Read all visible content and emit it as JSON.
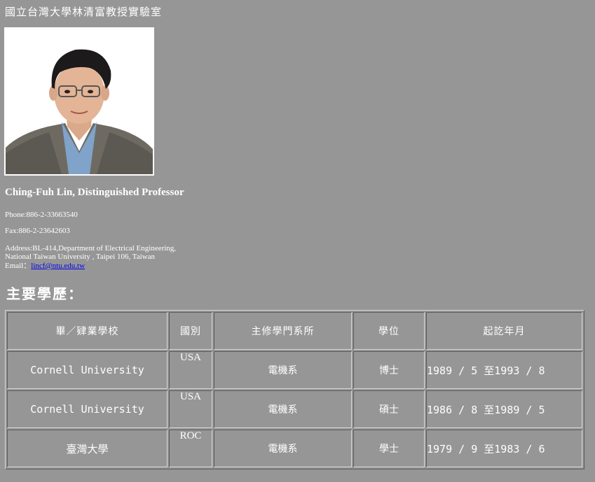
{
  "lab_title": "國立台灣大學林清富教授實驗室",
  "professor": {
    "name": "Ching-Fuh Lin, Distinguished Professor",
    "phone": "Phone:886-2-33663540",
    "fax": "Fax:886-2-23642603",
    "address_line1": "Address:BL-414,Department of Electrical Engineering,",
    "address_line2": "National Taiwan University , Taipei 106, Taiwan",
    "email_label": "Email：",
    "email": "lincf@ntu.edu.tw"
  },
  "education": {
    "section_title": "主要學歷：",
    "headers": [
      "畢／肄業學校",
      "國別",
      "主修學門系所",
      "學位",
      "起訖年月"
    ],
    "rows": [
      {
        "school": "Cornell University",
        "country": "USA",
        "major": "電機系",
        "degree": "博士",
        "period": "1989 / 5 至1993 / 8"
      },
      {
        "school": "Cornell University",
        "country": "USA",
        "major": "電機系",
        "degree": "碩士",
        "period": "1986 / 8 至1989 / 5"
      },
      {
        "school": "臺灣大學",
        "country": "ROC",
        "major": "電機系",
        "degree": "學士",
        "period": "1979 / 9 至1983 / 6"
      }
    ]
  }
}
